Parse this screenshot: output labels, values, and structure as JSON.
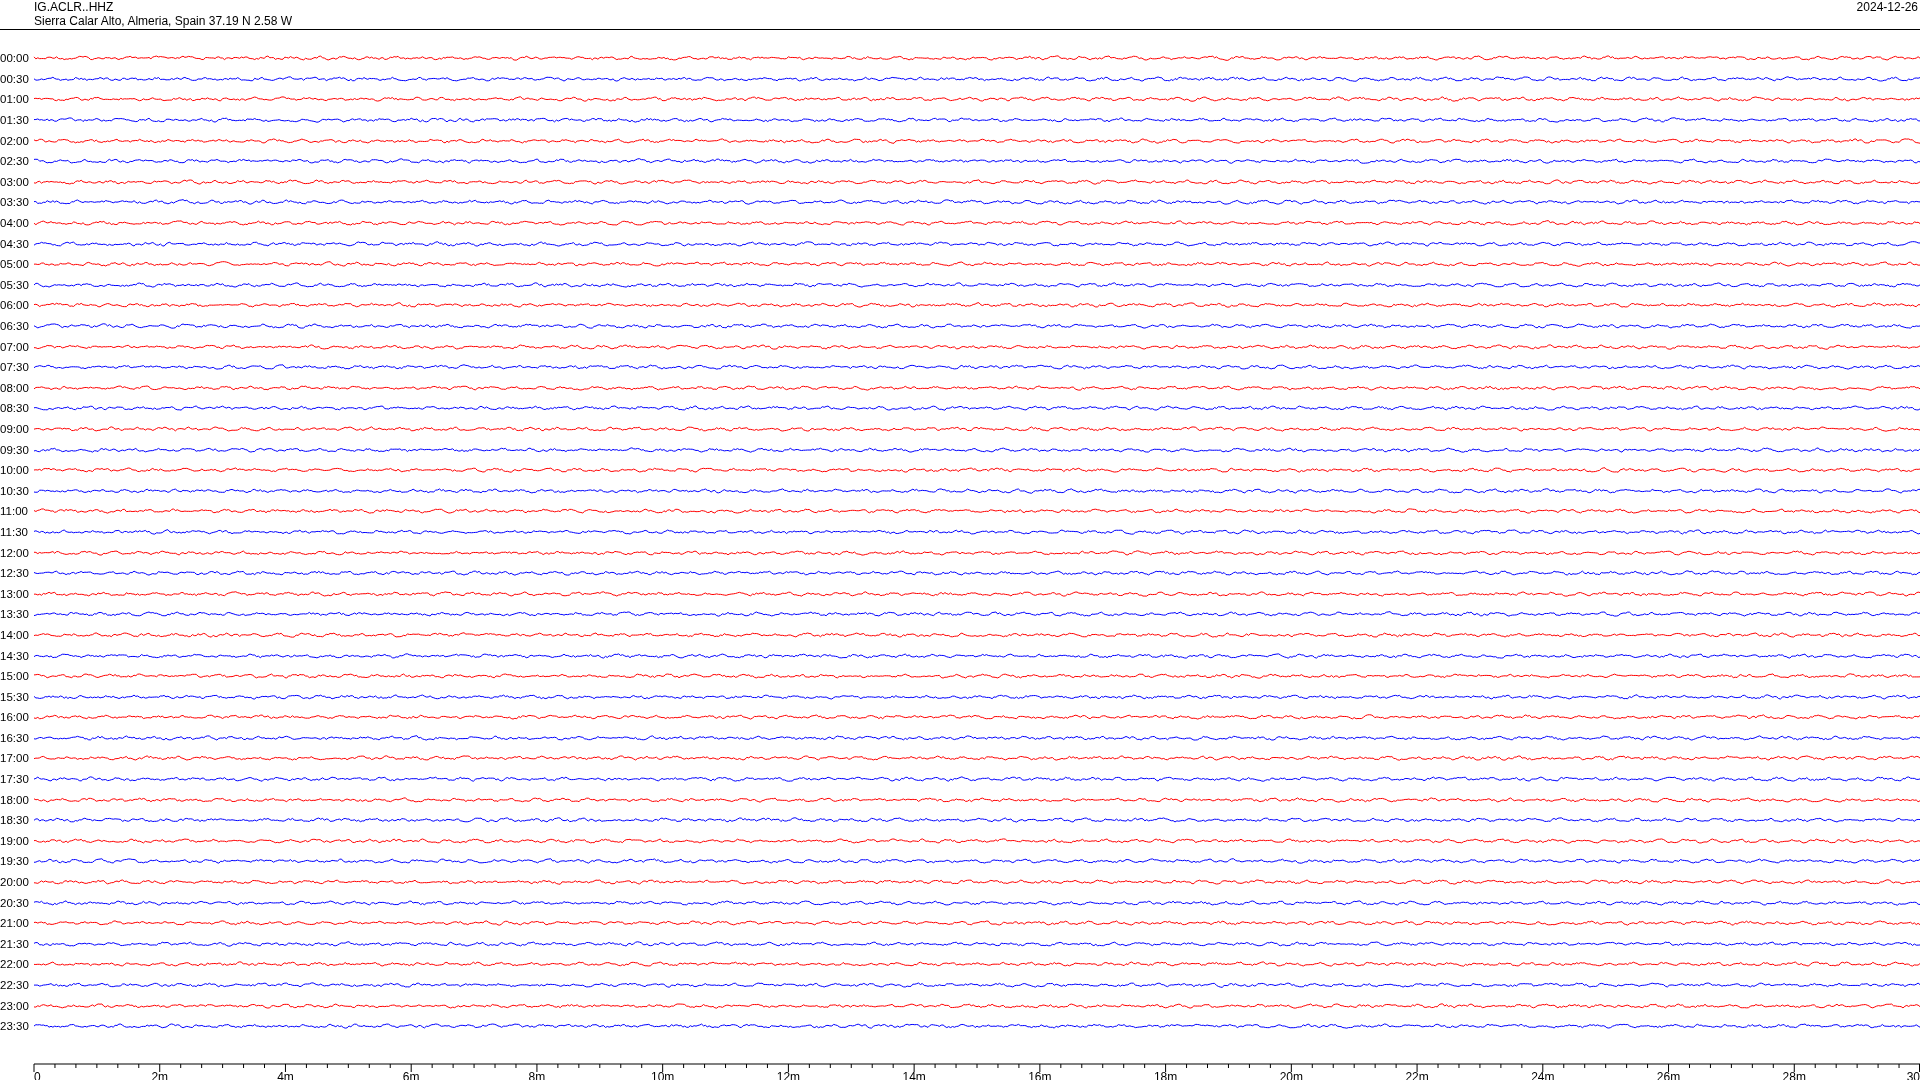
{
  "header": {
    "station": "IG.ACLR..HHZ",
    "location": "Sierra Calar Alto, Almeria, Spain  37.19 N 2.58 W",
    "date": "2024-12-26"
  },
  "traces": [
    {
      "label": "00:00",
      "color": "#ff0000"
    },
    {
      "label": "00:30",
      "color": "#0000ff"
    },
    {
      "label": "01:00",
      "color": "#ff0000"
    },
    {
      "label": "01:30",
      "color": "#0000ff"
    },
    {
      "label": "02:00",
      "color": "#ff0000"
    },
    {
      "label": "02:30",
      "color": "#0000ff"
    },
    {
      "label": "03:00",
      "color": "#ff0000"
    },
    {
      "label": "03:30",
      "color": "#0000ff"
    },
    {
      "label": "04:00",
      "color": "#ff0000"
    },
    {
      "label": "04:30",
      "color": "#0000ff"
    },
    {
      "label": "05:00",
      "color": "#ff0000"
    },
    {
      "label": "05:30",
      "color": "#0000ff"
    },
    {
      "label": "06:00",
      "color": "#ff0000"
    },
    {
      "label": "06:30",
      "color": "#0000ff"
    },
    {
      "label": "07:00",
      "color": "#ff0000"
    },
    {
      "label": "07:30",
      "color": "#0000ff"
    },
    {
      "label": "08:00",
      "color": "#ff0000"
    },
    {
      "label": "08:30",
      "color": "#0000ff"
    },
    {
      "label": "09:00",
      "color": "#ff0000"
    },
    {
      "label": "09:30",
      "color": "#0000ff"
    },
    {
      "label": "10:00",
      "color": "#ff0000"
    },
    {
      "label": "10:30",
      "color": "#0000ff"
    },
    {
      "label": "11:00",
      "color": "#ff0000"
    },
    {
      "label": "11:30",
      "color": "#0000ff"
    },
    {
      "label": "12:00",
      "color": "#ff0000"
    },
    {
      "label": "12:30",
      "color": "#0000ff"
    },
    {
      "label": "13:00",
      "color": "#ff0000"
    },
    {
      "label": "13:30",
      "color": "#0000ff"
    },
    {
      "label": "14:00",
      "color": "#ff0000"
    },
    {
      "label": "14:30",
      "color": "#0000ff"
    },
    {
      "label": "15:00",
      "color": "#ff0000"
    },
    {
      "label": "15:30",
      "color": "#0000ff"
    },
    {
      "label": "16:00",
      "color": "#ff0000"
    },
    {
      "label": "16:30",
      "color": "#0000ff"
    },
    {
      "label": "17:00",
      "color": "#ff0000"
    },
    {
      "label": "17:30",
      "color": "#0000ff"
    },
    {
      "label": "18:00",
      "color": "#ff0000"
    },
    {
      "label": "18:30",
      "color": "#0000ff"
    },
    {
      "label": "19:00",
      "color": "#ff0000"
    },
    {
      "label": "19:30",
      "color": "#0000ff"
    },
    {
      "label": "20:00",
      "color": "#ff0000"
    },
    {
      "label": "20:30",
      "color": "#0000ff"
    },
    {
      "label": "21:00",
      "color": "#ff0000"
    },
    {
      "label": "21:30",
      "color": "#0000ff"
    },
    {
      "label": "22:00",
      "color": "#ff0000"
    },
    {
      "label": "22:30",
      "color": "#0000ff"
    },
    {
      "label": "23:00",
      "color": "#ff0000"
    },
    {
      "label": "23:30",
      "color": "#0000ff"
    }
  ],
  "time_axis": {
    "ticks": [
      "0",
      "2m",
      "4m",
      "6m",
      "8m",
      "10m",
      "12m",
      "14m",
      "16m",
      "18m",
      "20m",
      "22m",
      "24m",
      "26m",
      "28m",
      "30"
    ]
  }
}
